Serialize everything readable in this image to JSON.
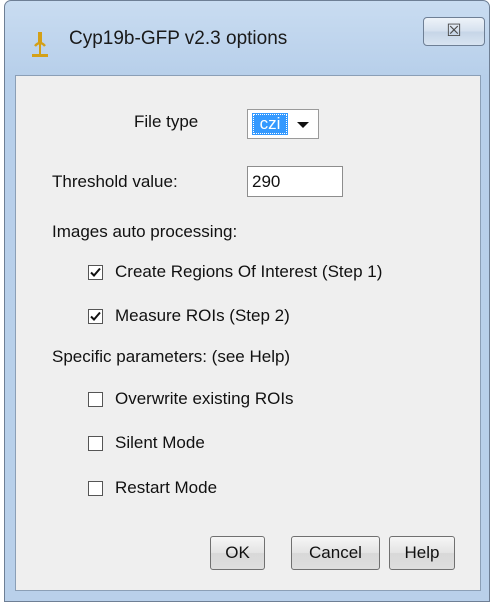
{
  "window": {
    "title": "Cyp19b-GFP v2.3 options",
    "close_glyph": "☒",
    "icon": "microscope-icon"
  },
  "form": {
    "file_type_label": "File type",
    "file_type_value": "czi",
    "threshold_label": "Threshold value:",
    "threshold_value": "290",
    "auto_processing_header": "Images auto processing:",
    "auto_processing": [
      {
        "label": "Create Regions Of Interest (Step 1)",
        "checked": true
      },
      {
        "label": "Measure ROIs (Step 2)",
        "checked": true
      }
    ],
    "specific_header": "Specific parameters: (see Help)",
    "specific": [
      {
        "label": "Overwrite existing ROIs",
        "checked": false
      },
      {
        "label": "Silent Mode",
        "checked": false
      },
      {
        "label": "Restart Mode",
        "checked": false
      }
    ]
  },
  "buttons": {
    "ok": "OK",
    "cancel": "Cancel",
    "help": "Help"
  },
  "colors": {
    "selection": "#3399ff",
    "frame": "#b9d0ea",
    "client": "#efefef"
  }
}
